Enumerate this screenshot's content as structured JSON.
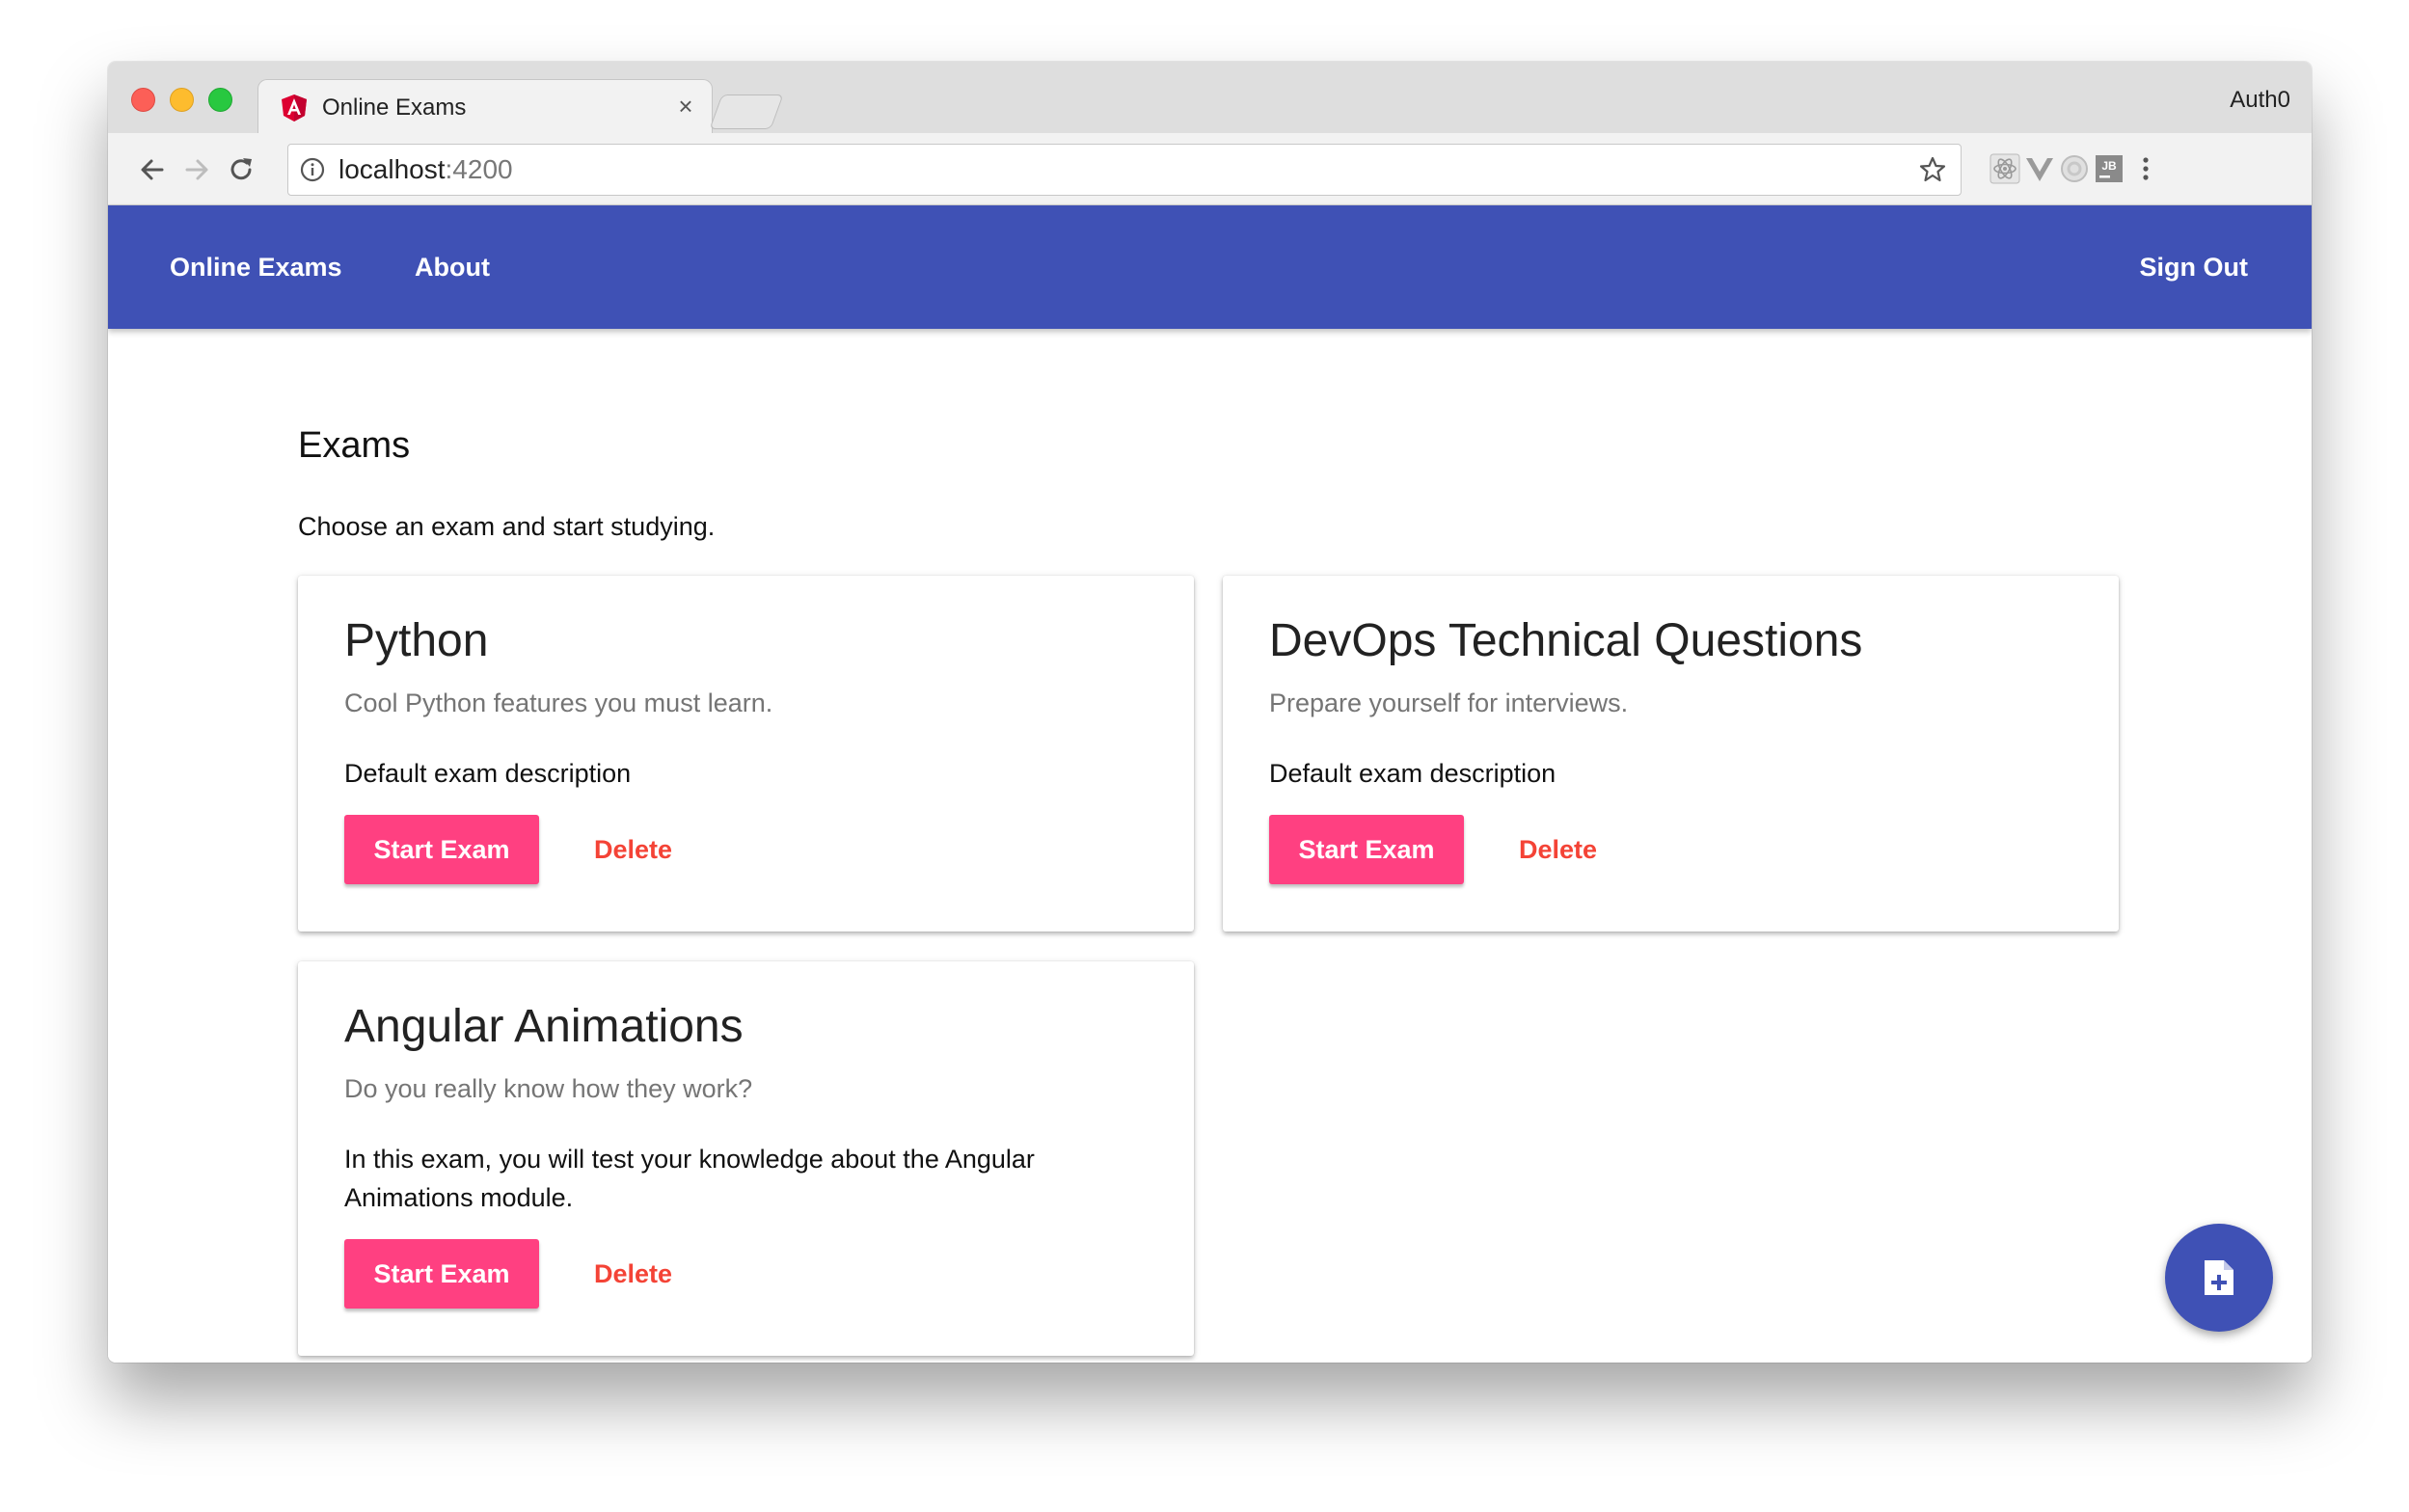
{
  "browser": {
    "tab_title": "Online Exams",
    "tab_close_glyph": "×",
    "profile_name": "Auth0",
    "url_host": "localhost",
    "url_port": ":4200",
    "extensions": [
      "react-devtools-icon",
      "vue-devtools-icon",
      "augury-icon",
      "jetbrains-icon"
    ]
  },
  "appbar": {
    "brand": "Online Exams",
    "about": "About",
    "sign_out": "Sign Out",
    "color": "#3f51b5"
  },
  "page": {
    "title": "Exams",
    "subtitle": "Choose an exam and start studying."
  },
  "exams": [
    {
      "title": "Python",
      "subtitle": "Cool Python features you must learn.",
      "description": "Default exam description",
      "start_label": "Start Exam",
      "delete_label": "Delete"
    },
    {
      "title": "DevOps Technical Questions",
      "subtitle": "Prepare yourself for interviews.",
      "description": "Default exam description",
      "start_label": "Start Exam",
      "delete_label": "Delete"
    },
    {
      "title": "Angular Animations",
      "subtitle": "Do you really know how they work?",
      "description": "In this exam, you will test your knowledge about the Angular Animations module.",
      "start_label": "Start Exam",
      "delete_label": "Delete"
    }
  ],
  "fab": {
    "icon": "note-add-icon"
  },
  "colors": {
    "accent": "#ff4081",
    "warn": "#f44336",
    "primary": "#3f51b5"
  }
}
